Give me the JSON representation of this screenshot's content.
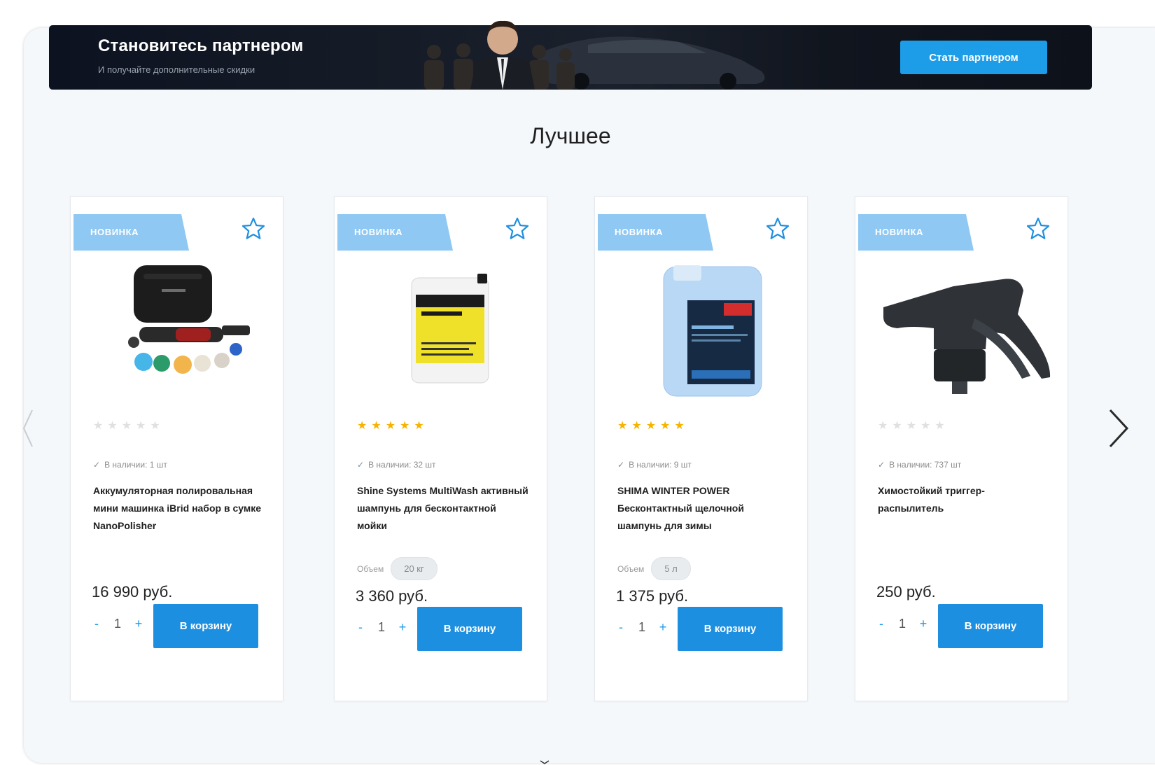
{
  "banner": {
    "title": "Становитесь партнером",
    "subtitle": "И получайте дополнительные скидки",
    "button_label": "Стать партнером"
  },
  "section": {
    "title": "Лучшее"
  },
  "colors": {
    "accent": "#1d9ce8",
    "badge": "#8fc8f3",
    "star": "#f6b400",
    "banner_bg": "#121826"
  },
  "products": [
    {
      "badge": "НОВИНКА",
      "icon": "star-outline-icon",
      "image": "polisher-kit-image",
      "rating": 0,
      "stock": "В наличии: 1 шт",
      "title": "Аккумуляторная полировальная мини машинка iBrid набор в сумке NanoPolisher",
      "volume_label": "",
      "volume_value": "",
      "price": "16 990 руб.",
      "qty": "1",
      "cart_label": "В корзину"
    },
    {
      "badge": "НОВИНКА",
      "icon": "star-outline-icon",
      "image": "shampoo-canister-image",
      "rating": 5,
      "stock": "В наличии: 32 шт",
      "title": "Shine Systems MultiWash активный шампунь для бесконтактной мойки",
      "volume_label": "Объем",
      "volume_value": "20 кг",
      "price": "3 360 руб.",
      "qty": "1",
      "cart_label": "В корзину"
    },
    {
      "badge": "НОВИНКА",
      "icon": "star-outline-icon",
      "image": "winter-shampoo-canister-image",
      "rating": 5,
      "stock": "В наличии: 9 шт",
      "title": "SHIMA WINTER POWER Бесконтактный щелочной шампунь для зимы",
      "volume_label": "Объем",
      "volume_value": "5 л",
      "price": "1 375 руб.",
      "qty": "1",
      "cart_label": "В корзину"
    },
    {
      "badge": "НОВИНКА",
      "icon": "star-outline-icon",
      "image": "trigger-sprayer-image",
      "rating": 0,
      "stock": "В наличии: 737 шт",
      "title": "Химостойкий триггер-распылитель",
      "volume_label": "",
      "volume_value": "",
      "price": "250 руб.",
      "qty": "1",
      "cart_label": "В корзину"
    }
  ],
  "qty_controls": {
    "minus": "-",
    "plus": "+"
  }
}
